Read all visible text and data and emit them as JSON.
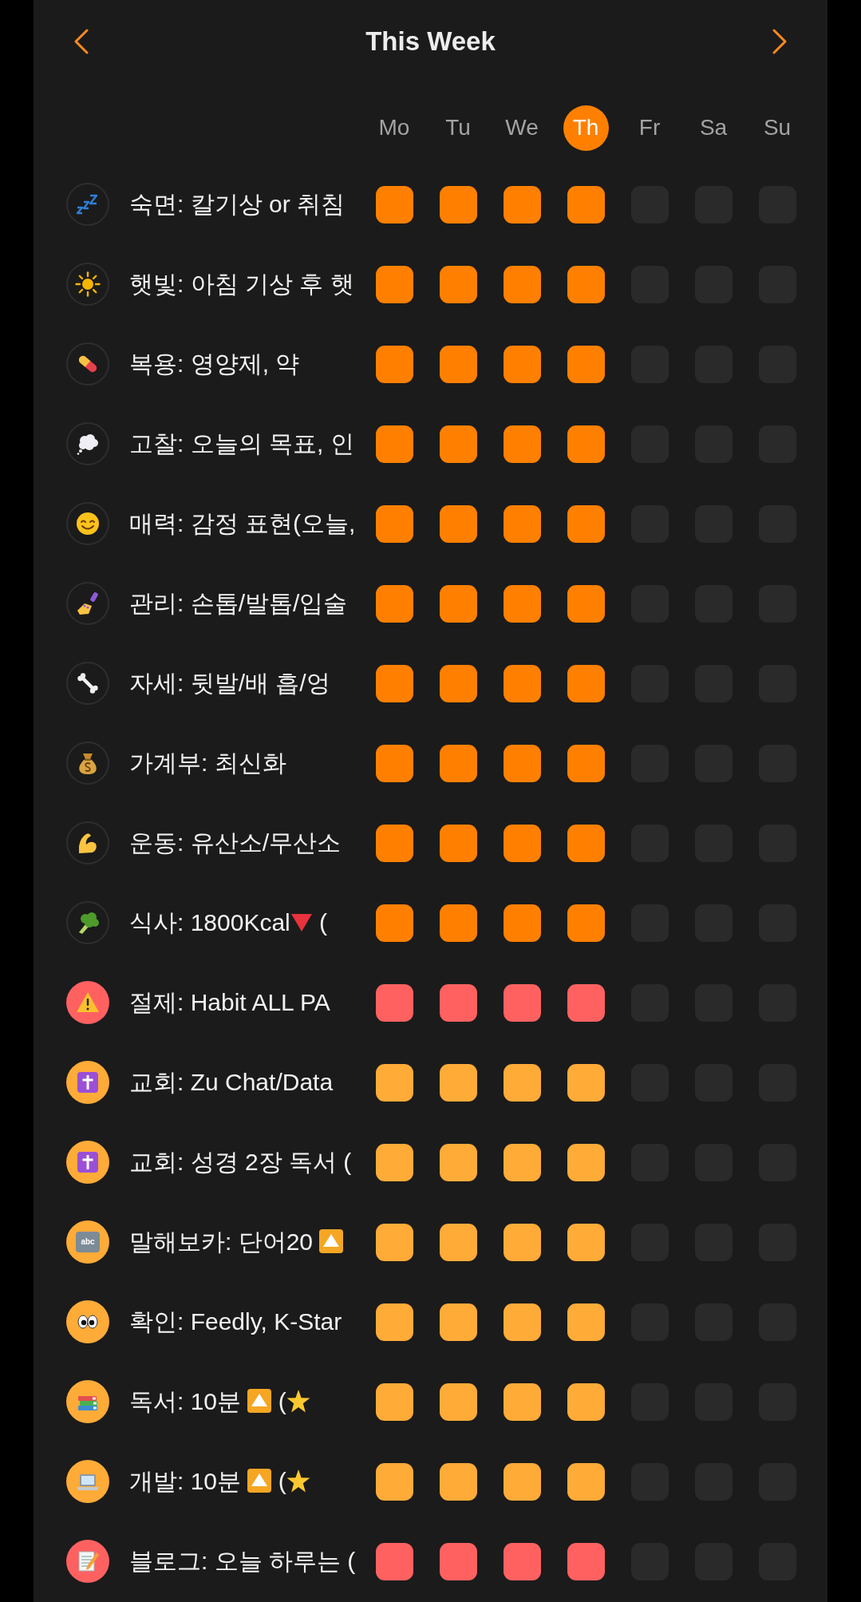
{
  "header": {
    "title": "This Week"
  },
  "days": [
    {
      "label": "Mo",
      "selected": false
    },
    {
      "label": "Tu",
      "selected": false
    },
    {
      "label": "We",
      "selected": false
    },
    {
      "label": "Th",
      "selected": true
    },
    {
      "label": "Fr",
      "selected": false
    },
    {
      "label": "Sa",
      "selected": false
    },
    {
      "label": "Su",
      "selected": false
    }
  ],
  "habits": [
    {
      "kind": "plain",
      "color": "#ff8000",
      "name": [
        {
          "kind": "text",
          "text": "숙면: 칼기상 or 취침"
        }
      ],
      "checks": [
        {
          "checked": true
        },
        {
          "checked": true
        },
        {
          "checked": true
        },
        {
          "checked": true
        },
        {
          "checked": false
        },
        {
          "checked": false
        },
        {
          "checked": false
        }
      ]
    },
    {
      "kind": "plain",
      "color": "#ff8000",
      "name": [
        {
          "kind": "text",
          "text": "햇빛: 아침 기상 후 햇"
        }
      ],
      "checks": [
        {
          "checked": true
        },
        {
          "checked": true
        },
        {
          "checked": true
        },
        {
          "checked": true
        },
        {
          "checked": false
        },
        {
          "checked": false
        },
        {
          "checked": false
        }
      ]
    },
    {
      "kind": "plain",
      "color": "#ff8000",
      "name": [
        {
          "kind": "text",
          "text": "복용: 영양제, 약"
        }
      ],
      "checks": [
        {
          "checked": true
        },
        {
          "checked": true
        },
        {
          "checked": true
        },
        {
          "checked": true
        },
        {
          "checked": false
        },
        {
          "checked": false
        },
        {
          "checked": false
        }
      ]
    },
    {
      "kind": "plain",
      "color": "#ff8000",
      "name": [
        {
          "kind": "text",
          "text": "고찰: 오늘의 목표, 인"
        }
      ],
      "checks": [
        {
          "checked": true
        },
        {
          "checked": true
        },
        {
          "checked": true
        },
        {
          "checked": true
        },
        {
          "checked": false
        },
        {
          "checked": false
        },
        {
          "checked": false
        }
      ]
    },
    {
      "kind": "plain",
      "color": "#ff8000",
      "name": [
        {
          "kind": "text",
          "text": "매력: 감정 표현(오늘,"
        }
      ],
      "checks": [
        {
          "checked": true
        },
        {
          "checked": true
        },
        {
          "checked": true
        },
        {
          "checked": true
        },
        {
          "checked": false
        },
        {
          "checked": false
        },
        {
          "checked": false
        }
      ]
    },
    {
      "kind": "plain",
      "color": "#ff8000",
      "name": [
        {
          "kind": "text",
          "text": "관리: 손톱/발톱/입술"
        }
      ],
      "checks": [
        {
          "checked": true
        },
        {
          "checked": true
        },
        {
          "checked": true
        },
        {
          "checked": true
        },
        {
          "checked": false
        },
        {
          "checked": false
        },
        {
          "checked": false
        }
      ]
    },
    {
      "kind": "plain",
      "color": "#ff8000",
      "name": [
        {
          "kind": "text",
          "text": "자세: 뒷발/배 흡/엉"
        }
      ],
      "checks": [
        {
          "checked": true
        },
        {
          "checked": true
        },
        {
          "checked": true
        },
        {
          "checked": true
        },
        {
          "checked": false
        },
        {
          "checked": false
        },
        {
          "checked": false
        }
      ]
    },
    {
      "kind": "plain",
      "color": "#ff8000",
      "name": [
        {
          "kind": "text",
          "text": "가계부: 최신화"
        }
      ],
      "checks": [
        {
          "checked": true
        },
        {
          "checked": true
        },
        {
          "checked": true
        },
        {
          "checked": true
        },
        {
          "checked": false
        },
        {
          "checked": false
        },
        {
          "checked": false
        }
      ]
    },
    {
      "kind": "plain",
      "color": "#ff8000",
      "name": [
        {
          "kind": "text",
          "text": "운동: 유산소/무산소"
        }
      ],
      "checks": [
        {
          "checked": true
        },
        {
          "checked": true
        },
        {
          "checked": true
        },
        {
          "checked": true
        },
        {
          "checked": false
        },
        {
          "checked": false
        },
        {
          "checked": false
        }
      ]
    },
    {
      "kind": "plain",
      "color": "#ff8000",
      "name": [
        {
          "kind": "text",
          "text": "식사: 1800Kcal"
        },
        {
          "kind": "down-triangle"
        },
        {
          "kind": "text",
          "text": " ("
        }
      ],
      "checks": [
        {
          "checked": true
        },
        {
          "checked": true
        },
        {
          "checked": true
        },
        {
          "checked": true
        },
        {
          "checked": false
        },
        {
          "checked": false
        },
        {
          "checked": false
        }
      ]
    },
    {
      "kind": "tinted",
      "color": "#ff6161",
      "name": [
        {
          "kind": "text",
          "text": "절제: Habit ALL PA"
        }
      ],
      "checks": [
        {
          "checked": true
        },
        {
          "checked": true
        },
        {
          "checked": true
        },
        {
          "checked": true
        },
        {
          "checked": false
        },
        {
          "checked": false
        },
        {
          "checked": false
        }
      ]
    },
    {
      "kind": "tinted",
      "color": "#ffab38",
      "name": [
        {
          "kind": "text",
          "text": "교회: Zu Chat/Data"
        }
      ],
      "checks": [
        {
          "checked": true
        },
        {
          "checked": true
        },
        {
          "checked": true
        },
        {
          "checked": true
        },
        {
          "checked": false
        },
        {
          "checked": false
        },
        {
          "checked": false
        }
      ]
    },
    {
      "kind": "tinted",
      "color": "#ffab38",
      "name": [
        {
          "kind": "text",
          "text": "교회: 성경 2장 독서 ("
        }
      ],
      "checks": [
        {
          "checked": true
        },
        {
          "checked": true
        },
        {
          "checked": true
        },
        {
          "checked": true
        },
        {
          "checked": false
        },
        {
          "checked": false
        },
        {
          "checked": false
        }
      ]
    },
    {
      "kind": "tinted",
      "color": "#ffab38",
      "icon_text": "abc",
      "name": [
        {
          "kind": "text",
          "text": "말해보카: 단어20 "
        },
        {
          "kind": "up-button"
        }
      ],
      "checks": [
        {
          "checked": true
        },
        {
          "checked": true
        },
        {
          "checked": true
        },
        {
          "checked": true
        },
        {
          "checked": false
        },
        {
          "checked": false
        },
        {
          "checked": false
        }
      ]
    },
    {
      "kind": "tinted",
      "color": "#ffab38",
      "name": [
        {
          "kind": "text",
          "text": "확인: Feedly, K-Star"
        }
      ],
      "checks": [
        {
          "checked": true
        },
        {
          "checked": true
        },
        {
          "checked": true
        },
        {
          "checked": true
        },
        {
          "checked": false
        },
        {
          "checked": false
        },
        {
          "checked": false
        }
      ]
    },
    {
      "kind": "tinted",
      "color": "#ffab38",
      "name": [
        {
          "kind": "text",
          "text": "독서: 10분 "
        },
        {
          "kind": "up-button"
        },
        {
          "kind": "text",
          "text": " ("
        },
        {
          "kind": "star"
        }
      ],
      "checks": [
        {
          "checked": true
        },
        {
          "checked": true
        },
        {
          "checked": true
        },
        {
          "checked": true
        },
        {
          "checked": false
        },
        {
          "checked": false
        },
        {
          "checked": false
        }
      ]
    },
    {
      "kind": "tinted",
      "color": "#ffab38",
      "name": [
        {
          "kind": "text",
          "text": "개발: 10분 "
        },
        {
          "kind": "up-button"
        },
        {
          "kind": "text",
          "text": " ("
        },
        {
          "kind": "star"
        }
      ],
      "checks": [
        {
          "checked": true
        },
        {
          "checked": true
        },
        {
          "checked": true
        },
        {
          "checked": true
        },
        {
          "checked": false
        },
        {
          "checked": false
        },
        {
          "checked": false
        }
      ]
    },
    {
      "kind": "tinted",
      "color": "#ff6161",
      "name": [
        {
          "kind": "text",
          "text": "블로그: 오늘 하루는 ("
        }
      ],
      "checks": [
        {
          "checked": true
        },
        {
          "checked": true
        },
        {
          "checked": true
        },
        {
          "checked": true
        },
        {
          "checked": false
        },
        {
          "checked": false
        },
        {
          "checked": false
        }
      ]
    }
  ]
}
